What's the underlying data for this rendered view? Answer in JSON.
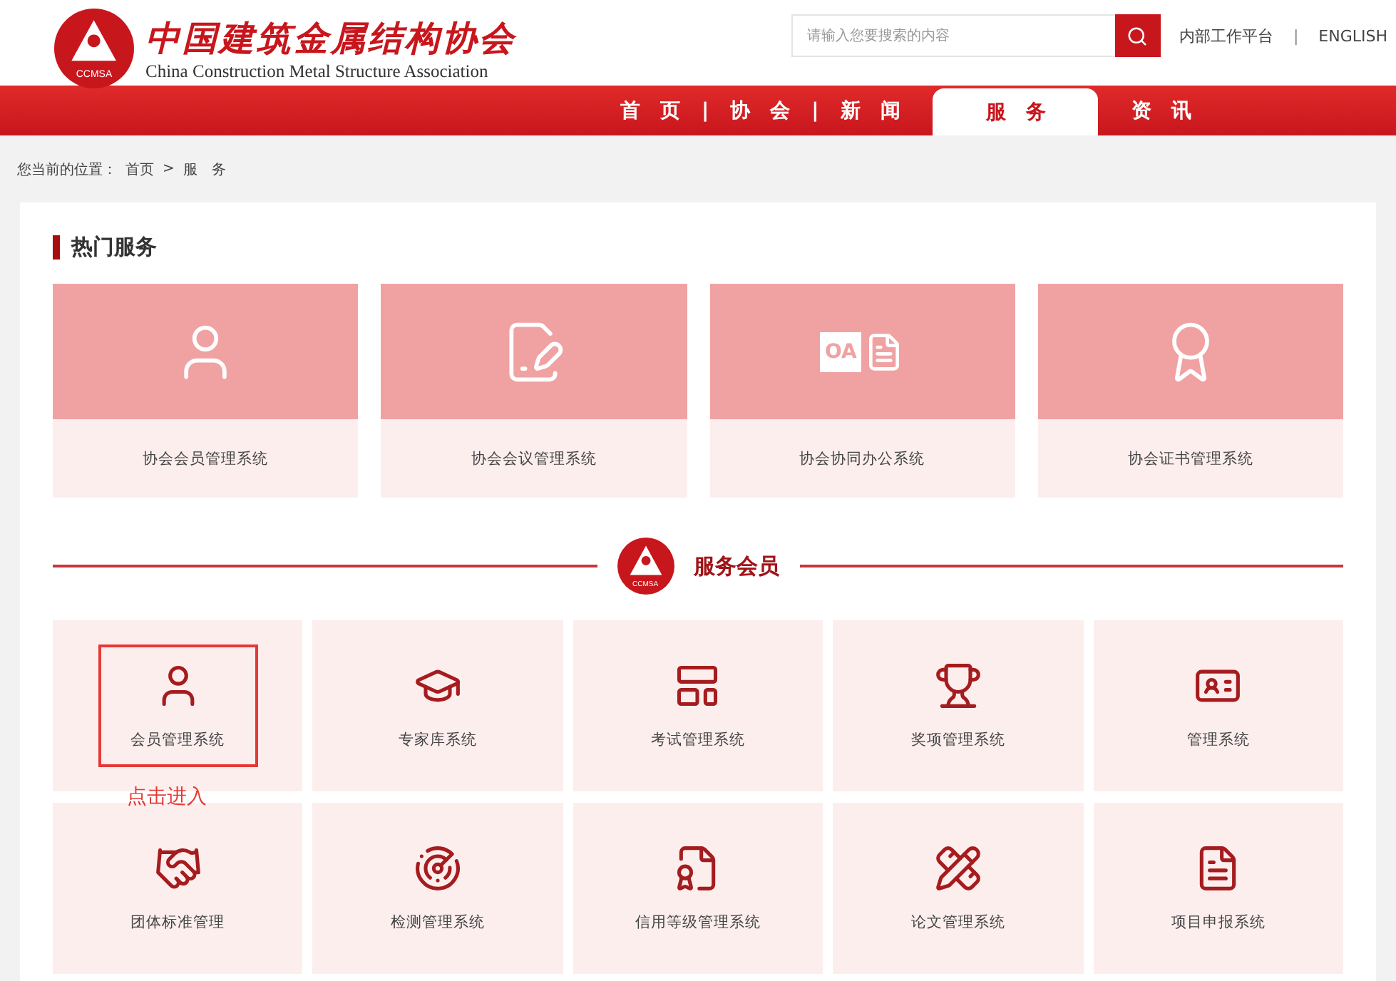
{
  "header": {
    "logo_mark": "CCMSA",
    "title_cn": "中国建筑金属结构协会",
    "title_en": "China Construction Metal Structure Association",
    "search": {
      "placeholder": "请输入您要搜索的内容"
    },
    "links": [
      "内部工作平台",
      "ENGLISH"
    ],
    "link_separator": "|"
  },
  "nav": {
    "separator": "|",
    "items": [
      {
        "label": "首　页",
        "selected": false
      },
      {
        "label": "协　会",
        "selected": false
      },
      {
        "label": "新　闻",
        "selected": false
      },
      {
        "label": "服　务",
        "selected": true
      },
      {
        "label": "资　讯",
        "selected": false
      }
    ]
  },
  "breadcrumb": {
    "prefix": "您当前的位置：",
    "items": [
      "首页",
      "服　务"
    ],
    "separator": ">"
  },
  "hot_services": {
    "title": "热门服务",
    "cards": [
      {
        "label": "协会会员管理系统"
      },
      {
        "label": "协会会议管理系统"
      },
      {
        "label": "协会协同办公系统",
        "icon_text": "OA"
      },
      {
        "label": "协会证书管理系统"
      }
    ]
  },
  "member_services": {
    "logo_mark": "CCMSA",
    "title": "服务会员",
    "tiles": [
      {
        "label": "会员管理系统",
        "highlighted": true,
        "annotation": "点击进入"
      },
      {
        "label": "专家库系统",
        "highlighted": false
      },
      {
        "label": "考试管理系统",
        "highlighted": false
      },
      {
        "label": "奖项管理系统",
        "highlighted": false
      },
      {
        "label": "管理系统",
        "highlighted": false
      },
      {
        "label": "团体标准管理",
        "highlighted": false
      },
      {
        "label": "检测管理系统",
        "highlighted": false
      },
      {
        "label": "信用等级管理系统",
        "highlighted": false
      },
      {
        "label": "论文管理系统",
        "highlighted": false
      },
      {
        "label": "项目申报系统",
        "highlighted": false
      }
    ]
  }
}
